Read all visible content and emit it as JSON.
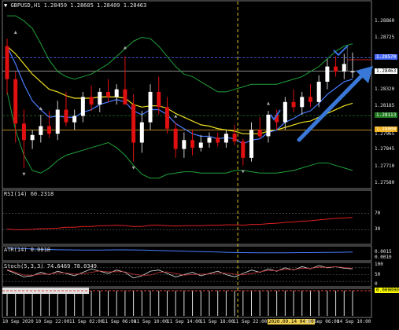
{
  "symbol_label": "GBPUSD,H1",
  "ohlc_label": "1.28459 1.28605 1.28409 1.28463",
  "price_axis": {
    "ticks": [
      "1.28860",
      "1.28725",
      "1.28463",
      "1.28320",
      "1.28185",
      "1.27965",
      "1.27845",
      "1.27710",
      "1.27580"
    ],
    "tags": [
      {
        "text": "1.28570",
        "color": "#4a6cff"
      },
      {
        "text": "1.28463",
        "color": "#ffffff"
      },
      {
        "text": "1.28113",
        "color": "#1f7a1f"
      },
      {
        "text": "1.28000",
        "color": "#f0b020"
      }
    ]
  },
  "rsi": {
    "label": "RSI(14) 60.2318",
    "levels": [
      "70",
      "30"
    ]
  },
  "atr": {
    "label": "ATR(14) 0.0018",
    "levels": [
      "0.0015",
      "0.0010"
    ]
  },
  "stoch": {
    "label": "Stoch(5,3,3) 74.6469 78.0349",
    "levels": [
      "100",
      "50",
      "0"
    ]
  },
  "bottom_axis_value": "0.000000",
  "time_axis": [
    {
      "text": "10 Sep 2020",
      "hl": false
    },
    {
      "text": "10 Sep 22:00",
      "hl": false
    },
    {
      "text": "11 Sep 02:00",
      "hl": false
    },
    {
      "text": "11 Sep 06:00",
      "hl": false
    },
    {
      "text": "11 Sep 10:00",
      "hl": false
    },
    {
      "text": "11 Sep 14:00",
      "hl": false
    },
    {
      "text": "11 Sep 18:00",
      "hl": false
    },
    {
      "text": "11 Sep 22:00",
      "hl": false
    },
    {
      "text": "2020.09.14 04:00",
      "hl": true
    },
    {
      "text": "14 Sep 06:00",
      "hl": false
    },
    {
      "text": "14 Sep 10:00",
      "hl": false
    }
  ],
  "colors": {
    "bull": "#ffffff",
    "bear": "#e01010",
    "ema_fast": "#4a7cff",
    "ema_slow": "#f0e020",
    "bollinger": "#1fa03a",
    "rsi": "#e02020",
    "atr": "#4a7cff",
    "stoch": "#ffffff",
    "dashed_vline": "#e0c020",
    "arrow": "#3a78d8"
  },
  "chart_data": [
    {
      "type": "candlestick",
      "title": "GBPUSD,H1",
      "ylim": [
        1.2755,
        1.2895
      ],
      "candles": [
        [
          1.2866,
          1.2872,
          1.2828,
          1.284
        ],
        [
          1.284,
          1.2846,
          1.279,
          1.2805
        ],
        [
          1.2805,
          1.2816,
          1.277,
          1.2792
        ],
        [
          1.2792,
          1.28,
          1.2785,
          1.2796
        ],
        [
          1.2796,
          1.2812,
          1.279,
          1.2803
        ],
        [
          1.2803,
          1.2815,
          1.2794,
          1.2797
        ],
        [
          1.2797,
          1.2823,
          1.2792,
          1.2816
        ],
        [
          1.2816,
          1.283,
          1.2803,
          1.2806
        ],
        [
          1.2806,
          1.2816,
          1.28,
          1.2811
        ],
        [
          1.2811,
          1.283,
          1.2806,
          1.2826
        ],
        [
          1.2826,
          1.2835,
          1.2815,
          1.282
        ],
        [
          1.282,
          1.2833,
          1.2814,
          1.283
        ],
        [
          1.283,
          1.284,
          1.2822,
          1.2826
        ],
        [
          1.2826,
          1.2836,
          1.282,
          1.2832
        ],
        [
          1.2832,
          1.2858,
          1.2826,
          1.282
        ],
        [
          1.282,
          1.2828,
          1.2775,
          1.279
        ],
        [
          1.279,
          1.2815,
          1.2782,
          1.2806
        ],
        [
          1.2806,
          1.2836,
          1.28,
          1.283
        ],
        [
          1.283,
          1.2842,
          1.2812,
          1.2818
        ],
        [
          1.2818,
          1.2826,
          1.2797,
          1.2801
        ],
        [
          1.2801,
          1.2806,
          1.2778,
          1.2785
        ],
        [
          1.2785,
          1.2798,
          1.2778,
          1.2792
        ],
        [
          1.2792,
          1.28,
          1.278,
          1.2786
        ],
        [
          1.2786,
          1.2796,
          1.2783,
          1.279
        ],
        [
          1.279,
          1.2798,
          1.2786,
          1.2794
        ],
        [
          1.2794,
          1.2798,
          1.2787,
          1.279
        ],
        [
          1.279,
          1.28,
          1.2786,
          1.2797
        ],
        [
          1.2797,
          1.2804,
          1.2788,
          1.2791
        ],
        [
          1.2791,
          1.2793,
          1.2772,
          1.2778
        ],
        [
          1.2778,
          1.2806,
          1.2775,
          1.28
        ],
        [
          1.28,
          1.281,
          1.2793,
          1.2795
        ],
        [
          1.2795,
          1.2815,
          1.279,
          1.2812
        ],
        [
          1.2812,
          1.2816,
          1.28,
          1.2806
        ],
        [
          1.2806,
          1.2826,
          1.28,
          1.2822
        ],
        [
          1.2822,
          1.2832,
          1.2814,
          1.2818
        ],
        [
          1.2818,
          1.283,
          1.2812,
          1.2826
        ],
        [
          1.2826,
          1.2836,
          1.2818,
          1.2822
        ],
        [
          1.2822,
          1.2843,
          1.2818,
          1.2838
        ],
        [
          1.2838,
          1.2856,
          1.2832,
          1.285
        ],
        [
          1.285,
          1.2858,
          1.2842,
          1.2846
        ],
        [
          1.2846,
          1.286,
          1.284,
          1.2852
        ],
        [
          1.2846,
          1.2861,
          1.2841,
          1.2846
        ]
      ],
      "ema_fast": [
        1.2866,
        1.2852,
        1.2836,
        1.2823,
        1.2816,
        1.281,
        1.2811,
        1.281,
        1.281,
        1.2814,
        1.2816,
        1.282,
        1.2822,
        1.2824,
        1.2822,
        1.2815,
        1.2812,
        1.2816,
        1.2816,
        1.2812,
        1.2805,
        1.2801,
        1.2797,
        1.2795,
        1.2795,
        1.2793,
        1.2794,
        1.2793,
        1.2789,
        1.2792,
        1.2793,
        1.2798,
        1.28,
        1.2806,
        1.2809,
        1.2813,
        1.2815,
        1.2821,
        1.2828,
        1.2833,
        1.2838,
        1.284
      ],
      "ema_slow": [
        1.2866,
        1.286,
        1.2852,
        1.2844,
        1.2838,
        1.2832,
        1.283,
        1.2827,
        1.2825,
        1.2825,
        1.2825,
        1.2826,
        1.2826,
        1.2826,
        1.2825,
        1.282,
        1.2818,
        1.2819,
        1.2819,
        1.2817,
        1.2813,
        1.281,
        1.2807,
        1.2804,
        1.2803,
        1.2801,
        1.28,
        1.2799,
        1.2797,
        1.2797,
        1.2797,
        1.2799,
        1.28,
        1.2802,
        1.2804,
        1.2806,
        1.2807,
        1.281,
        1.2813,
        1.2816,
        1.2819,
        1.2821
      ],
      "bb_upper": [
        1.289,
        1.289,
        1.2886,
        1.288,
        1.2868,
        1.2855,
        1.2846,
        1.2842,
        1.284,
        1.2842,
        1.2844,
        1.2848,
        1.2852,
        1.2858,
        1.2864,
        1.287,
        1.2873,
        1.2872,
        1.2866,
        1.2858,
        1.285,
        1.2844,
        1.2842,
        1.2838,
        1.2834,
        1.283,
        1.283,
        1.2832,
        1.2834,
        1.2836,
        1.2836,
        1.2836,
        1.2836,
        1.2838,
        1.284,
        1.2842,
        1.2846,
        1.285,
        1.2856,
        1.2862,
        1.2866,
        1.2868
      ],
      "bb_lower": [
        1.283,
        1.28,
        1.278,
        1.2768,
        1.2766,
        1.277,
        1.2776,
        1.278,
        1.2782,
        1.2784,
        1.2786,
        1.2788,
        1.279,
        1.2786,
        1.278,
        1.2772,
        1.2765,
        1.2762,
        1.2762,
        1.2765,
        1.2766,
        1.2767,
        1.2767,
        1.2766,
        1.2766,
        1.2766,
        1.2766,
        1.2768,
        1.2768,
        1.2767,
        1.2766,
        1.2766,
        1.2766,
        1.2767,
        1.2768,
        1.277,
        1.2772,
        1.2774,
        1.2774,
        1.2772,
        1.277,
        1.2768
      ]
    },
    {
      "type": "line",
      "title": "RSI(14) 60.2318",
      "ylim": [
        0,
        100
      ],
      "values": [
        32,
        30,
        30,
        31,
        33,
        33,
        34,
        36,
        36,
        38,
        38,
        40,
        40,
        41,
        40,
        38,
        38,
        41,
        41,
        40,
        39,
        40,
        40,
        40,
        41,
        41,
        42,
        42,
        41,
        43,
        43,
        45,
        46,
        48,
        49,
        51,
        52,
        54,
        56,
        58,
        59,
        60
      ]
    },
    {
      "type": "line",
      "title": "ATR(14) 0.0018",
      "ylim": [
        0.0008,
        0.002
      ],
      "values": [
        0.00188,
        0.00186,
        0.00184,
        0.0018,
        0.00177,
        0.00175,
        0.00173,
        0.00172,
        0.00171,
        0.0017,
        0.0017,
        0.0017,
        0.00171,
        0.00172,
        0.00172,
        0.00171,
        0.0017,
        0.00168,
        0.00166,
        0.00164,
        0.00162,
        0.0016,
        0.00158,
        0.00156,
        0.00154,
        0.00152,
        0.0015,
        0.00148,
        0.00147,
        0.00146,
        0.00145,
        0.00145,
        0.00145,
        0.00145,
        0.00146,
        0.00147,
        0.00147,
        0.00148,
        0.00149,
        0.0015,
        0.00151,
        0.00152
      ]
    },
    {
      "type": "line",
      "title": "Stoch(5,3,3) 74.6469 78.0349",
      "ylim": [
        0,
        100
      ],
      "series": [
        {
          "values": [
            70,
            55,
            40,
            45,
            60,
            50,
            65,
            55,
            45,
            60,
            75,
            65,
            55,
            70,
            60,
            35,
            45,
            65,
            70,
            55,
            40,
            50,
            60,
            45,
            55,
            65,
            50,
            40,
            55,
            70,
            60,
            75,
            65,
            80,
            70,
            85,
            75,
            90,
            80,
            85,
            78,
            75
          ]
        },
        {
          "values": [
            72,
            60,
            48,
            47,
            52,
            52,
            58,
            57,
            52,
            54,
            60,
            66,
            62,
            63,
            62,
            52,
            47,
            48,
            60,
            62,
            55,
            48,
            50,
            52,
            53,
            57,
            57,
            52,
            49,
            55,
            62,
            68,
            67,
            73,
            72,
            78,
            77,
            83,
            82,
            85,
            81,
            78
          ]
        }
      ]
    },
    {
      "type": "bar",
      "ylim": [
        -0.0001,
        0.0002
      ],
      "values": [
        2e-05,
        2e-05,
        2e-05,
        2e-05,
        2e-05,
        2e-05,
        2e-05,
        2e-05,
        2e-05,
        2e-05,
        2e-05,
        2e-05,
        2e-05,
        2e-05,
        2e-05,
        2e-05,
        2e-05,
        2e-05,
        2e-05,
        2e-05,
        2e-05,
        2e-05,
        2e-05,
        2e-05,
        2e-05,
        2e-05,
        2e-05,
        2e-05,
        2e-05,
        2e-05,
        2e-05,
        2e-05,
        2e-05,
        2e-05,
        2e-05,
        2e-05,
        2e-05,
        2e-05,
        2e-05,
        2e-05,
        2e-05,
        2e-05
      ]
    }
  ]
}
